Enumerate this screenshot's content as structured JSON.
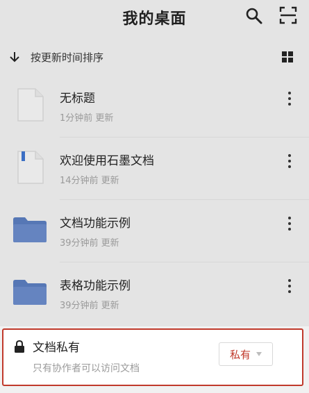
{
  "header": {
    "title": "我的桌面",
    "search_icon": "search-icon",
    "scan_icon": "scan-icon"
  },
  "sort_bar": {
    "label": "按更新时间排序",
    "sort_icon": "arrow-down-icon",
    "view_icon": "grid-view-icon"
  },
  "files": [
    {
      "name": "无标题",
      "meta": "1分钟前 更新",
      "type": "document"
    },
    {
      "name": "欢迎使用石墨文档",
      "meta": "14分钟前 更新",
      "type": "document"
    },
    {
      "name": "文档功能示例",
      "meta": "39分钟前 更新",
      "type": "folder"
    },
    {
      "name": "表格功能示例",
      "meta": "39分钟前 更新",
      "type": "folder"
    }
  ],
  "privacy": {
    "title": "文档私有",
    "description": "只有协作者可以访问文档",
    "selected": "私有",
    "lock_icon": "lock-icon"
  },
  "colors": {
    "accent": "#c0392b",
    "folder": "#5677b5",
    "doc_marker": "#3b6fc4"
  }
}
